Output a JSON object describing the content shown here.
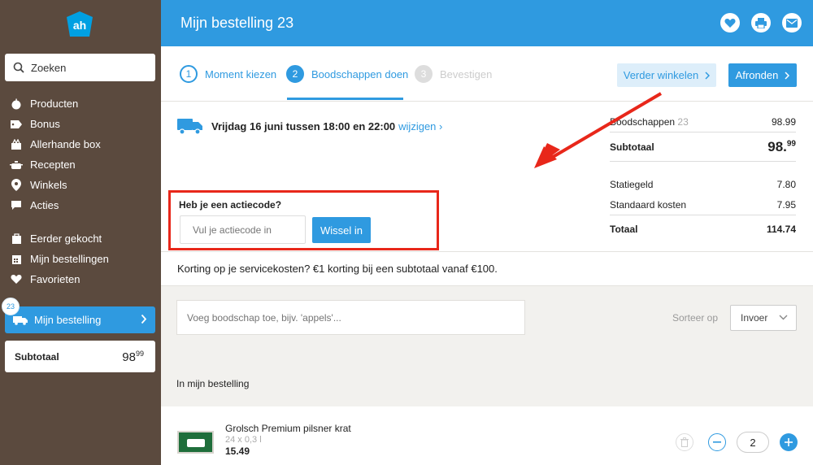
{
  "sidebar": {
    "search_label": "Zoeken",
    "items": [
      {
        "label": "Producten"
      },
      {
        "label": "Bonus"
      },
      {
        "label": "Allerhande box"
      },
      {
        "label": "Recepten"
      },
      {
        "label": "Winkels"
      },
      {
        "label": "Acties"
      },
      {
        "label": "Eerder gekocht"
      },
      {
        "label": "Mijn bestellingen"
      },
      {
        "label": "Favorieten"
      }
    ],
    "order_badge": "23",
    "order_label": "Mijn bestelling",
    "subtotal_label": "Subtotaal",
    "subtotal_main": "98",
    "subtotal_cents": "99"
  },
  "header": {
    "title": "Mijn bestelling 23",
    "icons": [
      "heart-icon",
      "print-icon",
      "mail-icon"
    ]
  },
  "steps": [
    {
      "num": "1",
      "label": "Moment kiezen"
    },
    {
      "num": "2",
      "label": "Boodschappen doen"
    },
    {
      "num": "3",
      "label": "Bevestigen"
    }
  ],
  "actions": {
    "continue_label": "Verder winkelen",
    "finish_label": "Afronden"
  },
  "delivery": {
    "text": "Vrijdag 16 juni tussen 18:00 en 22:00",
    "change_link": "wijzigen"
  },
  "promo": {
    "label": "Heb je een actiecode?",
    "placeholder": "Vul je actiecode in",
    "button": "Wissel in"
  },
  "summary": {
    "groceries_label": "Boodschappen",
    "groceries_count": "23",
    "groceries_value": "98.99",
    "subtotal_label": "Subtotaal",
    "subtotal_main": "98.",
    "subtotal_cents": "99",
    "deposit_label": "Statiegeld",
    "deposit_value": "7.80",
    "standard_label": "Standaard kosten",
    "standard_value": "7.95",
    "total_label": "Totaal",
    "total_value": "114.74"
  },
  "service_text": "Korting op je servicekosten? €1 korting bij een subtotaal vanaf €100.",
  "add": {
    "placeholder": "Voeg boodschap toe, bijv. 'appels'...",
    "sort_label": "Sorteer op",
    "sort_value": "Invoer"
  },
  "order_section_title": "In mijn bestelling",
  "product": {
    "name": "Grolsch Premium pilsner krat",
    "quantity": "24 x 0,3 l",
    "price": "15.49",
    "amount": "2"
  },
  "colors": {
    "brand_blue": "#2f9ae0",
    "sidebar_brown": "#5b4a3e",
    "highlight_red": "#e8271a"
  }
}
